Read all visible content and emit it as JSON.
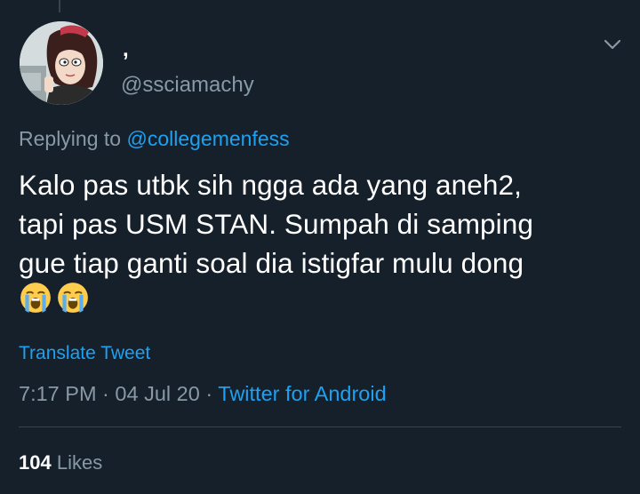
{
  "colors": {
    "background": "#15202b",
    "primary_text": "#ffffff",
    "secondary_text": "#8899a6",
    "link": "#1da1f2",
    "divider": "#38444d"
  },
  "author": {
    "display_name": ",",
    "handle": "@ssciamachy",
    "avatar_icon": "cartoon-girl-avatar"
  },
  "menu": {
    "icon": "chevron-down-icon"
  },
  "reply": {
    "prefix": "Replying to ",
    "mention": "@collegemenfess"
  },
  "tweet": {
    "text": "Kalo pas utbk sih ngga ada yang aneh2,\ntapi pas USM STAN. Sumpah di samping\ngue tiap ganti soal dia istigfar mulu dong",
    "emojis": [
      "loudly-crying-face-icon",
      "loudly-crying-face-icon"
    ]
  },
  "translate_label": "Translate Tweet",
  "meta": {
    "time": "7:17 PM",
    "separator": " · ",
    "date": "04 Jul 20",
    "source": "Twitter for Android"
  },
  "stats": {
    "likes_count": "104",
    "likes_label": "Likes"
  }
}
